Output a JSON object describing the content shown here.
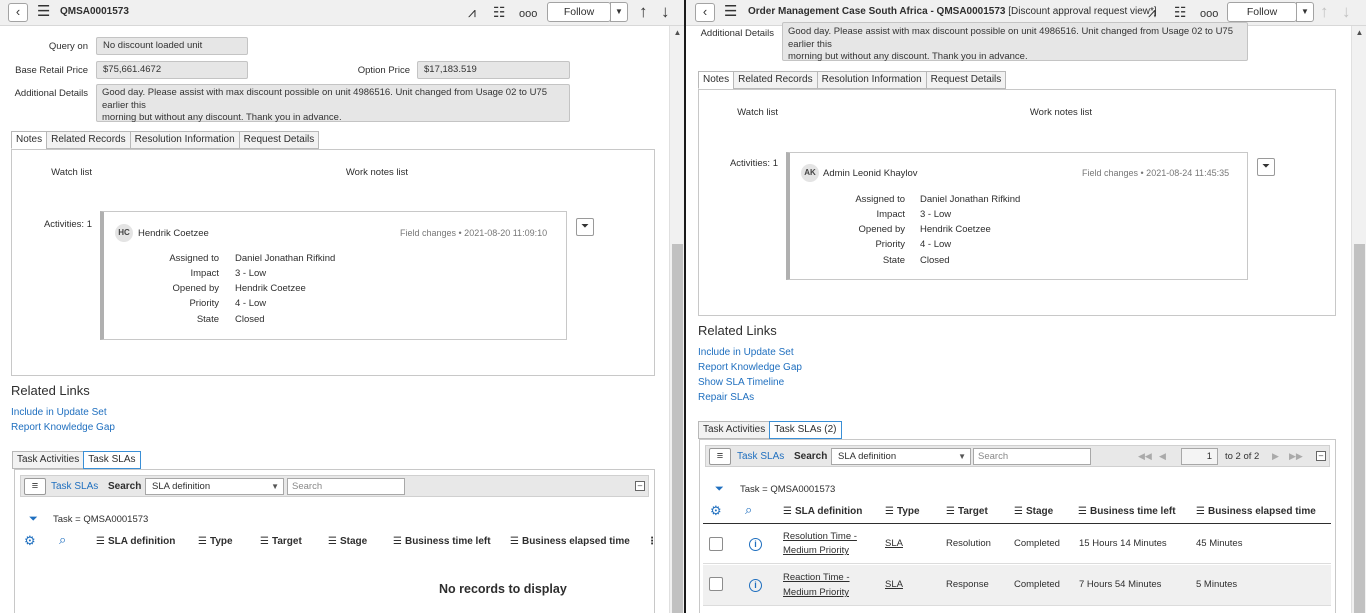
{
  "left": {
    "header": {
      "title": "QMSA0001573",
      "follow_label": "Follow"
    },
    "form": {
      "query_on_label": "Query on",
      "query_on_value": "No discount loaded unit",
      "base_retail_label": "Base Retail Price",
      "base_retail_value": "$75,661.4672",
      "option_price_label": "Option Price",
      "option_price_value": "$17,183.519",
      "additional_details_label": "Additional Details",
      "additional_details_line1": "Good day. Please assist with max discount possible on unit 4986516. Unit changed from Usage 02 to U75 earlier this",
      "additional_details_line2": "morning but without any discount. Thank you in advance."
    },
    "tabs": [
      "Notes",
      "Related Records",
      "Resolution Information",
      "Request Details"
    ],
    "notes": {
      "watch_list_label": "Watch list",
      "work_notes_list_label": "Work notes list",
      "activities_label": "Activities: 1",
      "activity": {
        "initials": "HC",
        "author": "Hendrik Coetzee",
        "meta": "Field changes  •  2021-08-20 11:09:10",
        "fields": [
          {
            "label": "Assigned to",
            "value": "Daniel Jonathan Rifkind"
          },
          {
            "label": "Impact",
            "value": "3 - Low"
          },
          {
            "label": "Opened by",
            "value": "Hendrik Coetzee"
          },
          {
            "label": "Priority",
            "value": "4 - Low"
          },
          {
            "label": "State",
            "value": "Closed"
          }
        ]
      }
    },
    "related_links": {
      "title": "Related Links",
      "links": [
        "Include in Update Set",
        "Report Knowledge Gap"
      ]
    },
    "bottom_tabs": [
      "Task Activities",
      "Task SLAs"
    ],
    "list": {
      "title": "Task SLAs",
      "search_label": "Search",
      "select_value": "SLA definition",
      "search_placeholder": "Search",
      "breadcrumb": "Task = QMSA0001573",
      "columns": [
        "SLA definition",
        "Type",
        "Target",
        "Stage",
        "Business time left",
        "Business elapsed time"
      ],
      "empty_text": "No records to display"
    }
  },
  "right": {
    "header": {
      "title": "Order Management Case South Africa - QMSA0001573",
      "view": " [Discount approval request view*]",
      "follow_label": "Follow"
    },
    "form": {
      "additional_details_label": "Additional Details",
      "additional_details_line1": "Good day. Please assist with max discount possible on unit 4986516. Unit changed from Usage 02 to U75 earlier this",
      "additional_details_line2": "morning but without any discount. Thank you in advance."
    },
    "tabs": [
      "Notes",
      "Related Records",
      "Resolution Information",
      "Request Details"
    ],
    "notes": {
      "watch_list_label": "Watch list",
      "work_notes_list_label": "Work notes list",
      "activities_label": "Activities: 1",
      "activity": {
        "initials": "AK",
        "author": "Admin Leonid Khaylov",
        "meta": "Field changes  •  2021-08-24 11:45:35",
        "fields": [
          {
            "label": "Assigned to",
            "value": "Daniel Jonathan Rifkind"
          },
          {
            "label": "Impact",
            "value": "3 - Low"
          },
          {
            "label": "Opened by",
            "value": "Hendrik Coetzee"
          },
          {
            "label": "Priority",
            "value": "4 - Low"
          },
          {
            "label": "State",
            "value": "Closed"
          }
        ]
      }
    },
    "related_links": {
      "title": "Related Links",
      "links": [
        "Include in Update Set",
        "Report Knowledge Gap",
        "Show SLA Timeline",
        "Repair SLAs"
      ]
    },
    "bottom_tabs": [
      "Task Activities",
      "Task SLAs (2)"
    ],
    "list": {
      "title": "Task SLAs",
      "search_label": "Search",
      "select_value": "SLA definition",
      "search_placeholder": "Search",
      "page_value": "1",
      "page_text": "to 2 of 2",
      "breadcrumb": "Task = QMSA0001573",
      "columns": [
        "SLA definition",
        "Type",
        "Target",
        "Stage",
        "Business time left",
        "Business elapsed time"
      ],
      "rows": [
        {
          "sla_line1": "Resolution Time -",
          "sla_line2": "Medium Priority",
          "type": "SLA",
          "target": "Resolution",
          "stage": "Completed",
          "time_left": "15 Hours 14 Minutes",
          "elapsed": "45 Minutes"
        },
        {
          "sla_line1": "Reaction Time -",
          "sla_line2": "Medium Priority",
          "type": "SLA",
          "target": "Response",
          "stage": "Completed",
          "time_left": "7 Hours 54 Minutes",
          "elapsed": "5 Minutes"
        }
      ]
    }
  }
}
